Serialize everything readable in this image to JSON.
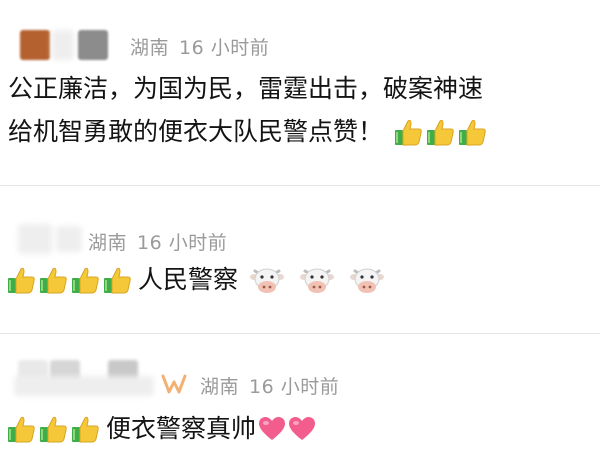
{
  "comments": [
    {
      "location": "湖南",
      "time": "16 小时前",
      "lines": [
        "公正廉洁，为国为民，雷霆出击，破案神速",
        "给机智勇敢的便衣大队民警点赞！"
      ],
      "emoji": [
        "thumbs-up-icon",
        "thumbs-up-icon",
        "thumbs-up-icon"
      ]
    },
    {
      "location": "湖南",
      "time": "16 小时前",
      "text": "人民警察",
      "emoji_before": [
        "thumbs-up-icon",
        "thumbs-up-icon",
        "thumbs-up-icon",
        "thumbs-up-icon"
      ],
      "emoji_after": [
        "cow-face-icon",
        "cow-face-icon",
        "cow-face-icon"
      ]
    },
    {
      "location": "湖南",
      "time": "16 小时前",
      "text": "便衣警察真帅",
      "emoji_before": [
        "thumbs-up-icon",
        "thumbs-up-icon",
        "thumbs-up-icon"
      ],
      "emoji_after": [
        "pink-heart-icon",
        "pink-heart-icon"
      ]
    }
  ],
  "colors": {
    "meta_gray": "#9a9a9a",
    "thumb_yellow": "#f5c83a",
    "cuff_green": "#3fae49",
    "heart_pink": "#f25d8e",
    "avatar_brown": "#b5612f"
  }
}
